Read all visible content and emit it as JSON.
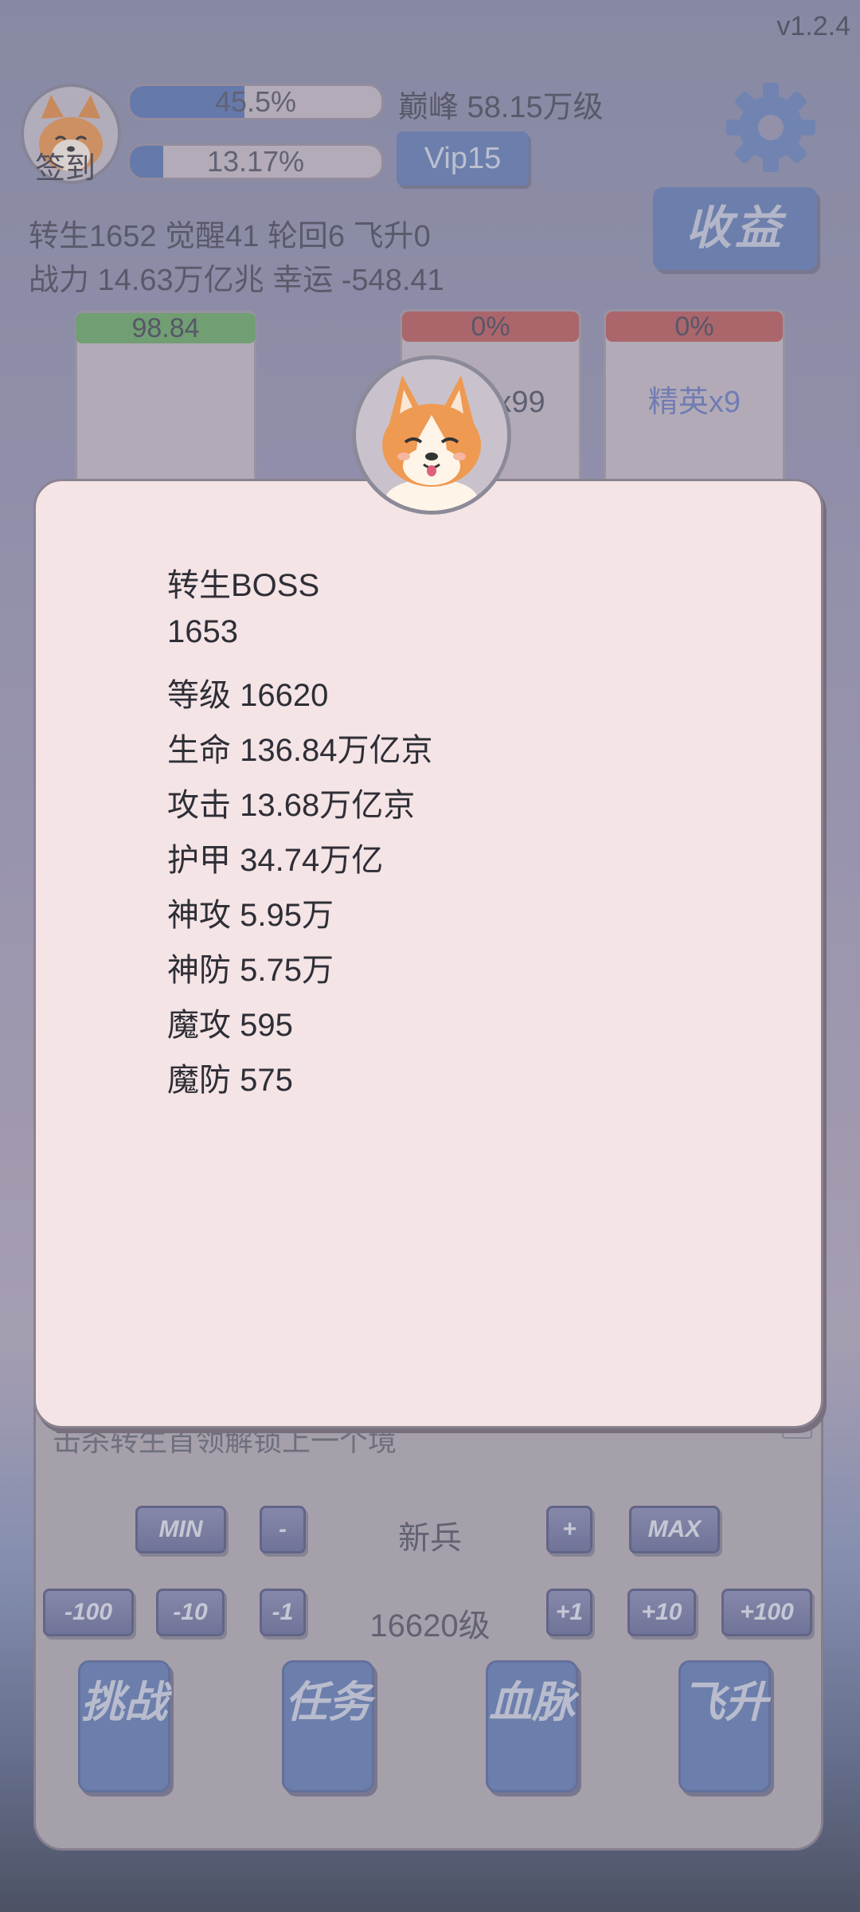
{
  "header": {
    "version": "v1.2.4",
    "signin_label": "签到",
    "exp_bar": {
      "percent_text": "45.5%",
      "fill": 0.455
    },
    "second_bar": {
      "percent_text": "13.17%",
      "fill": 0.1317
    },
    "peak_text": "巅峰 58.15万级",
    "vip_label": "Vip15",
    "income_label": "收益",
    "stats_line1": "转生1652 觉醒41 轮回6 飞升0",
    "stats_line2": "战力 14.63万亿兆  幸运 -548.41"
  },
  "cards": {
    "left": {
      "value": "98.84",
      "color": "#6fae6a"
    },
    "middle": {
      "percent": "0%",
      "label": "小怪x99",
      "color": "#c06060"
    },
    "right": {
      "percent": "0%",
      "label": "精英x9",
      "color": "#c06060"
    }
  },
  "modal": {
    "lines": [
      "转生BOSS",
      "1653",
      "等级 16620",
      "生命 136.84万亿京",
      "攻击 13.68万亿京",
      "护甲 34.74万亿",
      "神攻 5.95万",
      "神防 5.75万",
      "魔攻 595",
      "魔防 575"
    ]
  },
  "controls": {
    "partial_text": "击杀转生首领解锁上一个境",
    "min_label": "MIN",
    "minus_label": "-",
    "rank_text": "新兵",
    "plus_label": "+",
    "max_label": "MAX",
    "m100": "-100",
    "m10": "-10",
    "m1": "-1",
    "level_text": "16620级",
    "p1": "+1",
    "p10": "+10",
    "p100": "+100"
  },
  "actions": {
    "challenge": "挑战",
    "task": "任务",
    "bloodline": "血脉",
    "ascend": "飞升"
  }
}
